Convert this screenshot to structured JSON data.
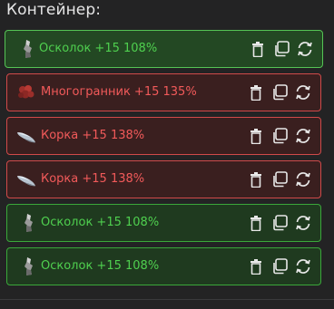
{
  "container": {
    "title": "Контейнер:"
  },
  "items": [
    {
      "label": "Осколок +15 108%",
      "status": "good",
      "icon": "shard-icon"
    },
    {
      "label": "Многогранник +15 135%",
      "status": "bad",
      "icon": "polyhedron-icon"
    },
    {
      "label": "Корка +15 138%",
      "status": "bad",
      "icon": "crust-icon"
    },
    {
      "label": "Корка +15 138%",
      "status": "bad",
      "icon": "crust-icon"
    },
    {
      "label": "Осколок +15 108%",
      "status": "good",
      "icon": "shard-icon"
    },
    {
      "label": "Осколок +15 108%",
      "status": "good",
      "icon": "shard-icon"
    }
  ],
  "colors": {
    "good_text": "#4fd04f",
    "bad_text": "#f25a5a",
    "good_border": "#3aa83a",
    "bad_border": "#d04a4a"
  }
}
